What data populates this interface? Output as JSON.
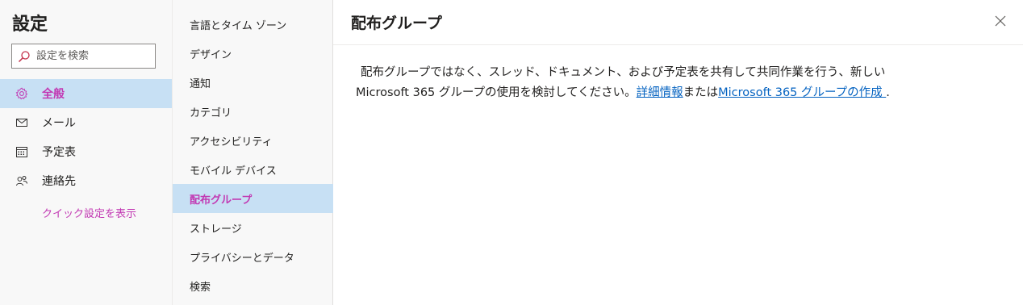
{
  "settings": {
    "title": "設定",
    "search_placeholder": "設定を検索"
  },
  "nav": {
    "items": [
      {
        "label": "全般",
        "icon": "gear-icon"
      },
      {
        "label": "メール",
        "icon": "mail-icon"
      },
      {
        "label": "予定表",
        "icon": "calendar-icon"
      },
      {
        "label": "連絡先",
        "icon": "people-icon"
      }
    ],
    "quick_settings_link": "クイック設定を表示"
  },
  "subnav": {
    "items": [
      "言語とタイム ゾーン",
      "デザイン",
      "通知",
      "カテゴリ",
      "アクセシビリティ",
      "モバイル デバイス",
      "配布グループ",
      "ストレージ",
      "プライバシーとデータ",
      "検索"
    ]
  },
  "pane": {
    "title": "配布グループ",
    "text_line1": "配布グループではなく、スレッド、ドキュメント、および予定表を共有して共同作業を行う、新しい",
    "text_line2_prefix": "Microsoft 365 グループの使用を検討してください。",
    "link_details": "詳細情報",
    "text_or": "または",
    "link_create": "Microsoft 365 グループの作成 ",
    "text_end": "."
  },
  "colors": {
    "accent": "#c239b3",
    "selected_bg": "#c7e0f4",
    "link": "#0563c1",
    "sidebar_bg": "#f8f8f8"
  }
}
